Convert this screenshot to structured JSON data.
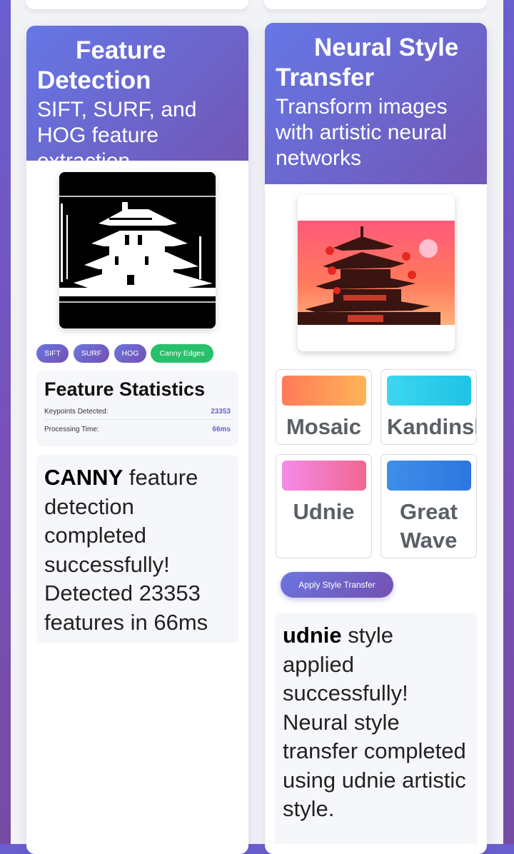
{
  "feature_card": {
    "title": "Feature Detection",
    "subtitle": "SIFT, SURF, and HOG feature extraction",
    "tabs": [
      {
        "label": "SIFT"
      },
      {
        "label": "SURF"
      },
      {
        "label": "HOG"
      },
      {
        "label": "Canny Edges"
      }
    ],
    "active_tab": "Canny Edges",
    "stats": {
      "heading": "Feature Statistics",
      "keypoints_label": "Keypoints Detected:",
      "keypoints_value": "23353",
      "time_label": "Processing Time:",
      "time_value": "66ms"
    },
    "result": {
      "method": "CANNY",
      "message": " feature detection completed successfully! Detected 23353 features in 66ms"
    }
  },
  "style_card": {
    "title": "Neural Style Transfer",
    "subtitle": "Transform images with artistic neural networks",
    "styles": [
      {
        "name": "Mosaic",
        "color_from": "#ff7a5a",
        "color_to": "#ffb457"
      },
      {
        "name": "Kandinsky",
        "color_from": "#3dd6ef",
        "color_to": "#1ec3e6"
      },
      {
        "name": "Udnie",
        "color_from": "#f48be9",
        "color_to": "#f2668f"
      },
      {
        "name": "Great Wave",
        "color_from": "#3f8fe8",
        "color_to": "#2d77e0"
      }
    ],
    "apply_label": "Apply Style Transfer",
    "result": {
      "style": "udnie",
      "message": " style applied successfully! Neural style transfer completed using udnie artistic style."
    }
  },
  "colors": {
    "accent": "#6a5fd0",
    "header_from": "#6577e6",
    "header_to": "#7257b6",
    "active_chip": "#28c06a"
  }
}
